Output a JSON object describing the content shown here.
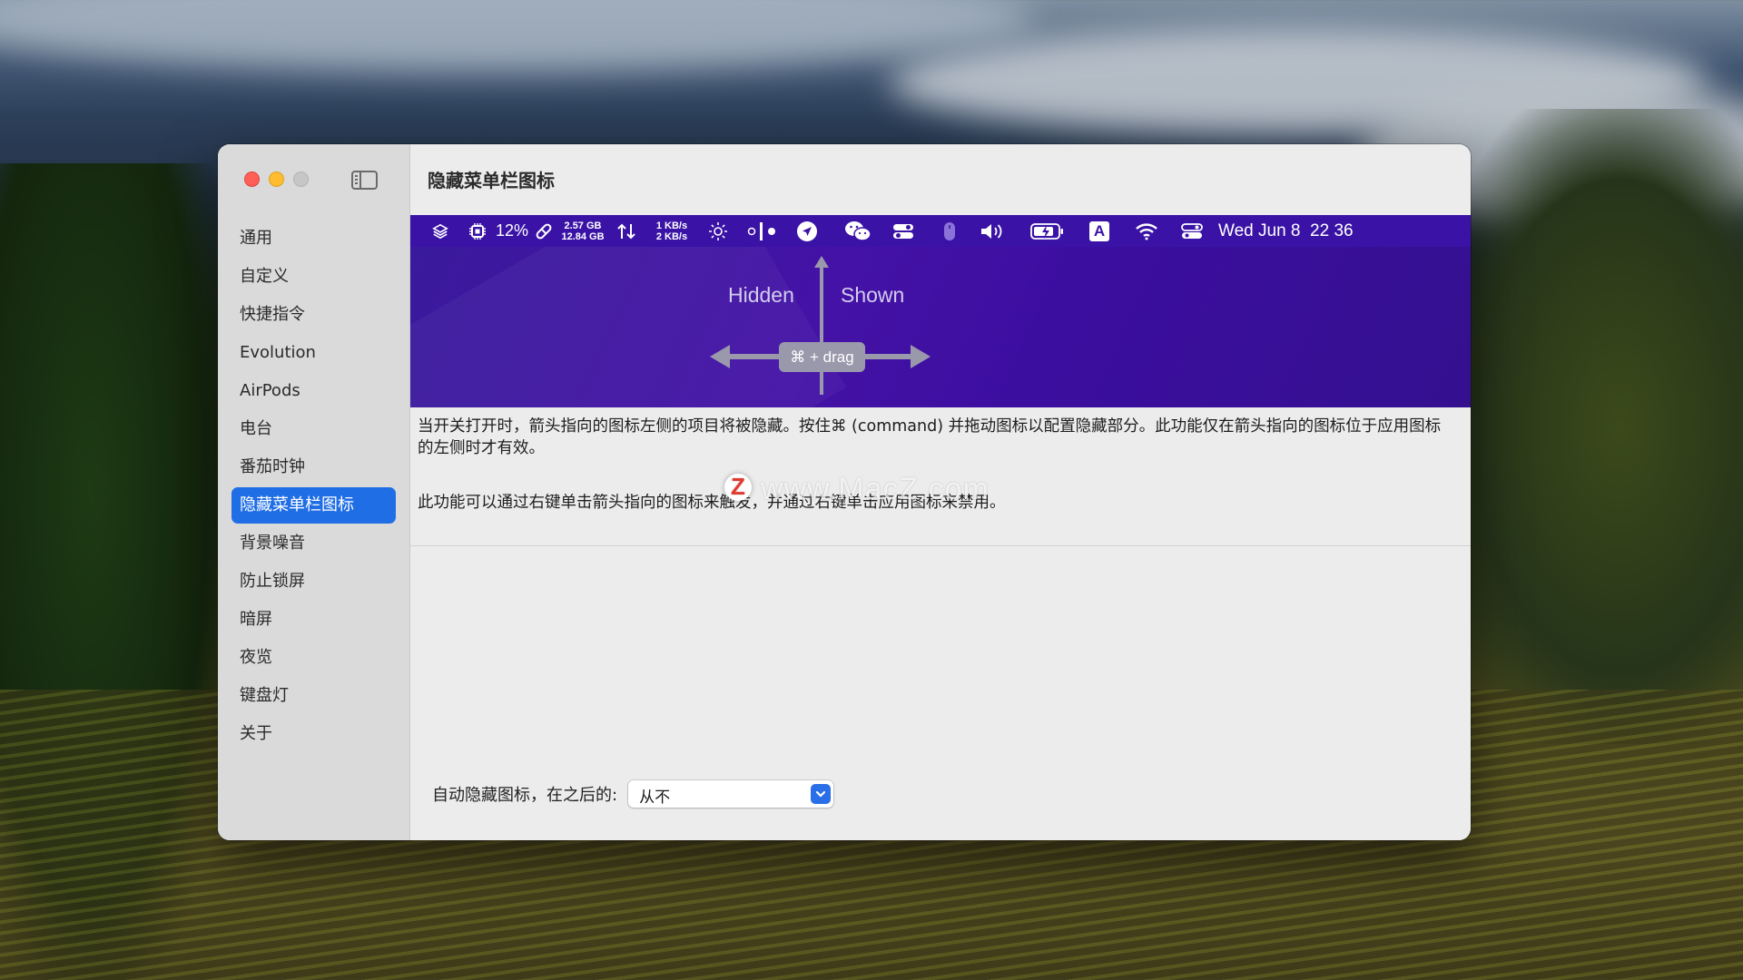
{
  "window": {
    "title": "隐藏菜单栏图标"
  },
  "sidebar": {
    "items": [
      {
        "label": "通用",
        "active": false
      },
      {
        "label": "自定义",
        "active": false
      },
      {
        "label": "快捷指令",
        "active": false
      },
      {
        "label": "Evolution",
        "active": false
      },
      {
        "label": "AirPods",
        "active": false
      },
      {
        "label": "电台",
        "active": false
      },
      {
        "label": "番茄时钟",
        "active": false
      },
      {
        "label": "隐藏菜单栏图标",
        "active": true
      },
      {
        "label": "背景噪音",
        "active": false
      },
      {
        "label": "防止锁屏",
        "active": false
      },
      {
        "label": "暗屏",
        "active": false
      },
      {
        "label": "夜览",
        "active": false
      },
      {
        "label": "键盘灯",
        "active": false
      },
      {
        "label": "关于",
        "active": false
      }
    ]
  },
  "menubar_preview": {
    "cpu": "12%",
    "memory_used": "2.57 GB",
    "memory_total": "12.84 GB",
    "net_up": "1 KB/s",
    "net_down": "2 KB/s",
    "keyboard_input": "A",
    "clock": "Wed Jun 8  22 36",
    "icons": [
      "layers-icon",
      "cpu-icon",
      "pill-icon",
      "arrows-updown-icon",
      "brightness-icon",
      "separator-toggle-icon",
      "send-icon",
      "wechat-icon",
      "toggle-icon",
      "mouse-icon",
      "volume-icon",
      "battery-icon",
      "input-source-icon",
      "wifi-icon",
      "control-center-icon"
    ]
  },
  "demo": {
    "hidden_label": "Hidden",
    "shown_label": "Shown",
    "drag_hint": "⌘ + drag"
  },
  "description": {
    "paragraph1": "当开关打开时，箭头指向的图标左侧的项目将被隐藏。按住⌘ (command) 并拖动图标以配置隐藏部分。此功能仅在箭头指向的图标位于应用图标的左侧时才有效。",
    "paragraph2": "此功能可以通过右键单击箭头指向的图标来触发，并通过右键单击应用图标来禁用。"
  },
  "auto_hide": {
    "label": "自动隐藏图标，在之后的:",
    "value": "从不"
  },
  "watermark": "www.MacZ.com",
  "colors": {
    "accent": "#1f6ee6",
    "preview_bg": "#3c0ea0",
    "close": "#ff5f57",
    "minimize": "#febc2e"
  }
}
